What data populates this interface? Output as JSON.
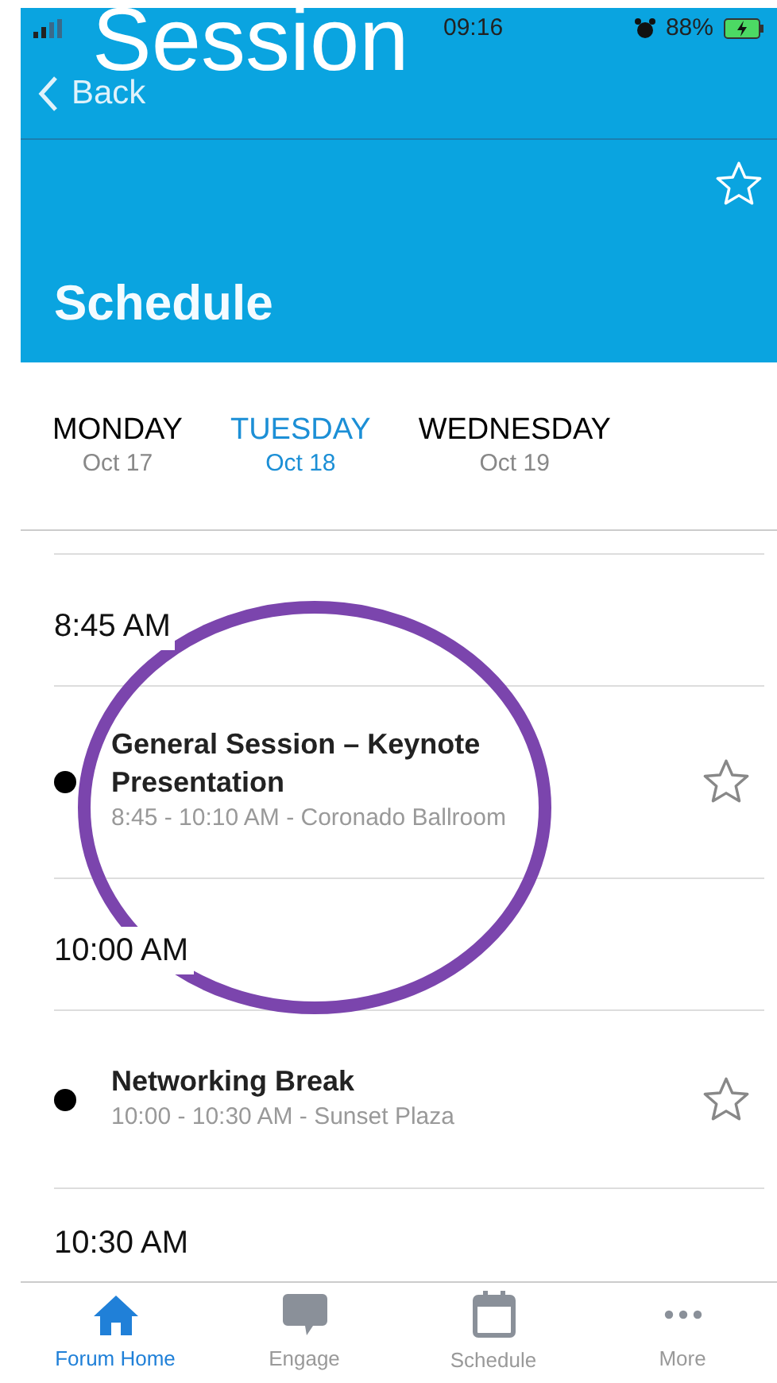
{
  "overlay_caption": "Session",
  "status_bar": {
    "time": "09:16",
    "battery": "88%"
  },
  "nav": {
    "back": "Back",
    "title": "Schedule",
    "favorite": false
  },
  "days": [
    {
      "day": "MONDAY",
      "date": "Oct 17",
      "selected": false
    },
    {
      "day": "TUESDAY",
      "date": "Oct 18",
      "selected": true
    },
    {
      "day": "WEDNESDAY",
      "date": "Oct 19",
      "selected": false
    }
  ],
  "schedule": [
    {
      "kind": "time",
      "label": "8:45 AM"
    },
    {
      "kind": "session",
      "title": "General Session – Keynote Presentation",
      "details": "8:45 - 10:10 AM - Coronado Ballroom",
      "favorite": false,
      "circled": true
    },
    {
      "kind": "time",
      "label": "10:00 AM"
    },
    {
      "kind": "session",
      "title": "Networking Break",
      "details": "10:00 - 10:30 AM - Sunset Plaza",
      "favorite": false,
      "circled": false
    },
    {
      "kind": "time",
      "label": "10:30 AM"
    }
  ],
  "tab_bar": [
    {
      "label": "Forum Home",
      "selected": true
    },
    {
      "label": "Engage",
      "selected": false
    },
    {
      "label": "Schedule",
      "selected": false
    },
    {
      "label": "More",
      "selected": false
    }
  ]
}
